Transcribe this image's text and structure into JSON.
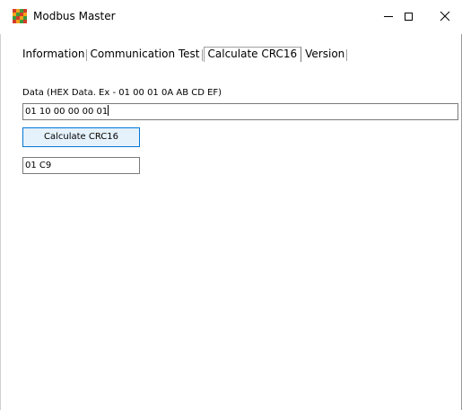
{
  "window": {
    "title": "Modbus Master",
    "icon": "modbus-app-icon",
    "controls": [
      "minimize-icon",
      "maximize-icon",
      "close-icon"
    ]
  },
  "tabs": [
    {
      "label": "Information",
      "active": false
    },
    {
      "label": "Communication Test",
      "active": false
    },
    {
      "label": "Calculate CRC16",
      "active": true
    },
    {
      "label": "Version",
      "active": false
    }
  ],
  "crc": {
    "data_label": "Data (HEX Data. Ex - 01 00 01 0A AB CD EF)",
    "data_value": "01 10 00 00 00 01",
    "calculate_label": "Calculate CRC16",
    "result_value": "01 C9"
  },
  "colors": {
    "button_border": "#0078d7",
    "button_fill": "#e5f1fb",
    "input_border": "#7a7a7a"
  }
}
